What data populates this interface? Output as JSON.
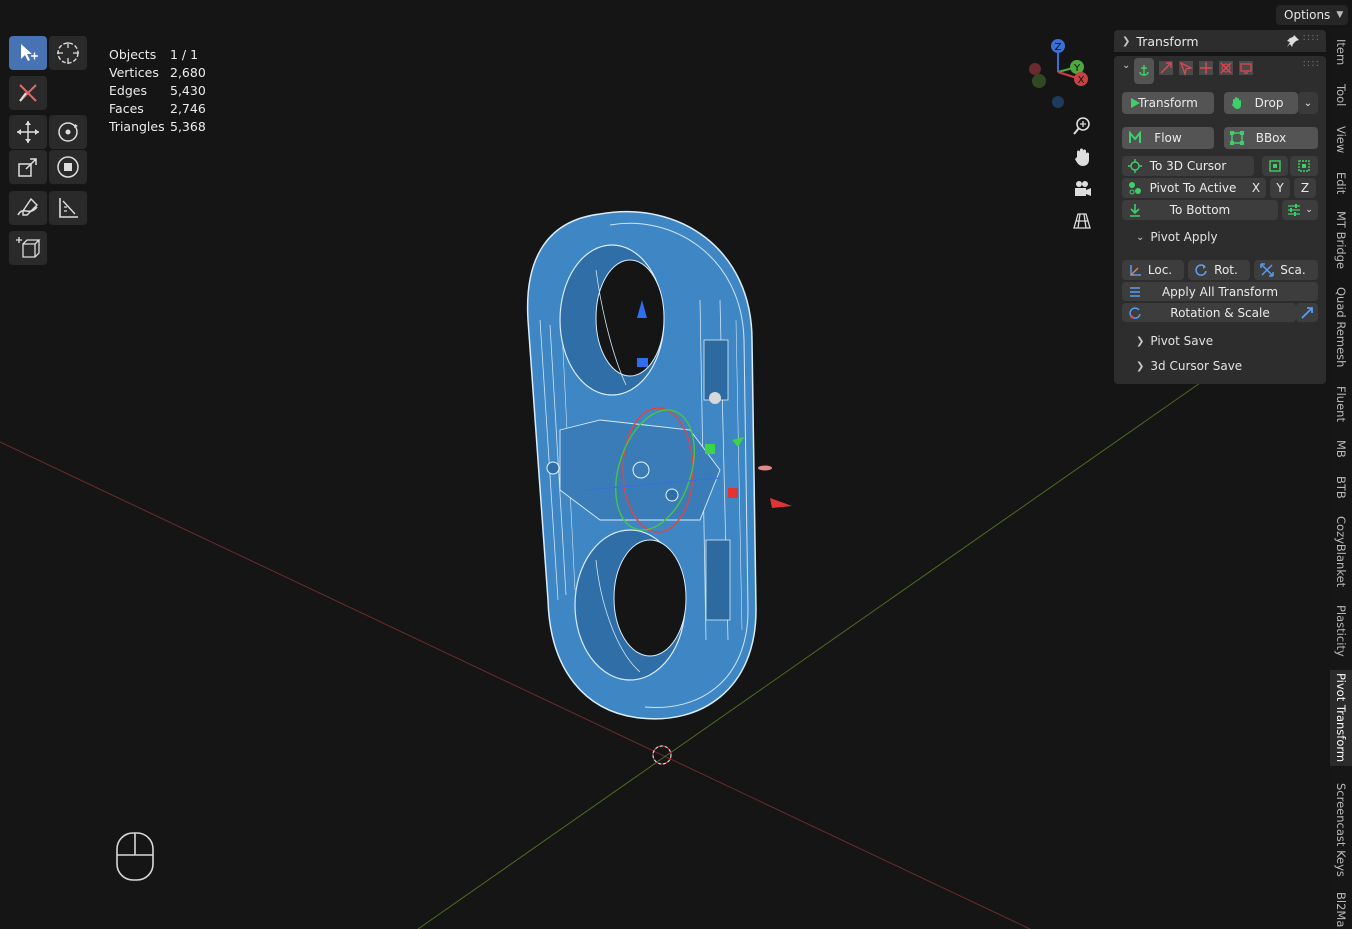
{
  "stats": [
    {
      "label": "Objects",
      "value": "1 / 1"
    },
    {
      "label": "Vertices",
      "value": "2,680"
    },
    {
      "label": "Edges",
      "value": "5,430"
    },
    {
      "label": "Faces",
      "value": "2,746"
    },
    {
      "label": "Triangles",
      "value": "5,368"
    }
  ],
  "options_label": "Options",
  "gizmo": {
    "z": "Z",
    "y": "Y",
    "x": "X"
  },
  "panel": {
    "header": "Transform",
    "transform_btn": "Transform",
    "drop_btn": "Drop",
    "flow_btn": "Flow",
    "bbox_btn": "BBox",
    "to_cursor_btn": "To 3D Cursor",
    "pivot_active_btn": "Pivot To Active",
    "axis_x": "X",
    "axis_y": "Y",
    "axis_z": "Z",
    "to_bottom_btn": "To Bottom",
    "pivot_apply": "Pivot Apply",
    "loc_btn": "Loc.",
    "rot_btn": "Rot.",
    "sca_btn": "Sca.",
    "apply_all_btn": "Apply All Transform",
    "rot_scale_btn": "Rotation & Scale",
    "pivot_save": "Pivot Save",
    "cursor_save": "3d Cursor Save"
  },
  "side_tabs": [
    "Item",
    "Tool",
    "View",
    "Edit",
    "MT Bridge",
    "Quad Remesh",
    "Fluent",
    "MB",
    "BTB",
    "CozyBlanket",
    "Plasticity",
    "Pivot Transform",
    "Screencast Keys",
    "Bl2Ma"
  ],
  "active_tab": "Pivot Transform",
  "colors": {
    "accent": "#4772b3",
    "mesh": "#3f86c4",
    "green_icon": "#3ecf6a",
    "red_icon": "#e0464e"
  }
}
